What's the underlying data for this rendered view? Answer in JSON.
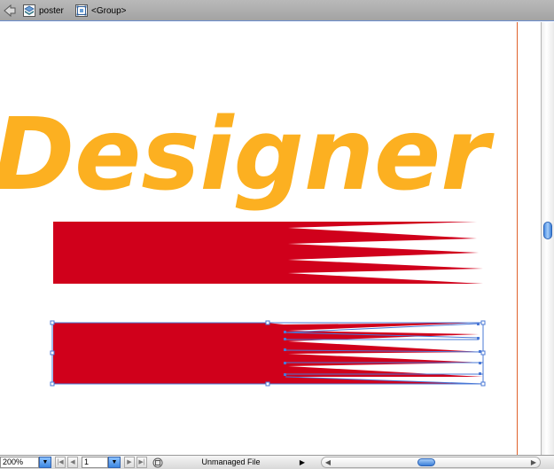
{
  "breadcrumb": {
    "back_icon": "back-arrow-icon",
    "items": [
      {
        "label": "poster",
        "icon": "layer-icon"
      },
      {
        "label": "<Group>",
        "icon": "group-icon"
      }
    ]
  },
  "canvas": {
    "title_text": "Designer",
    "title_color": "#fcb021",
    "shape_color": "#d0001b",
    "selection_color": "#4a78d6",
    "artboard_edge_color": "#e0622c"
  },
  "scrollbar": {
    "vertical_position": 0.48,
    "horizontal_position": 0.47
  },
  "statusbar": {
    "zoom_value": "200%",
    "page_value": "1",
    "status_text": "Unmanaged File",
    "first_label": "|◀",
    "prev_label": "◀",
    "next_label": "▶",
    "last_label": "▶|",
    "dropdown_label": "▼",
    "status_arrow": "▶",
    "left_arrow": "◀",
    "right_arrow": "▶"
  }
}
